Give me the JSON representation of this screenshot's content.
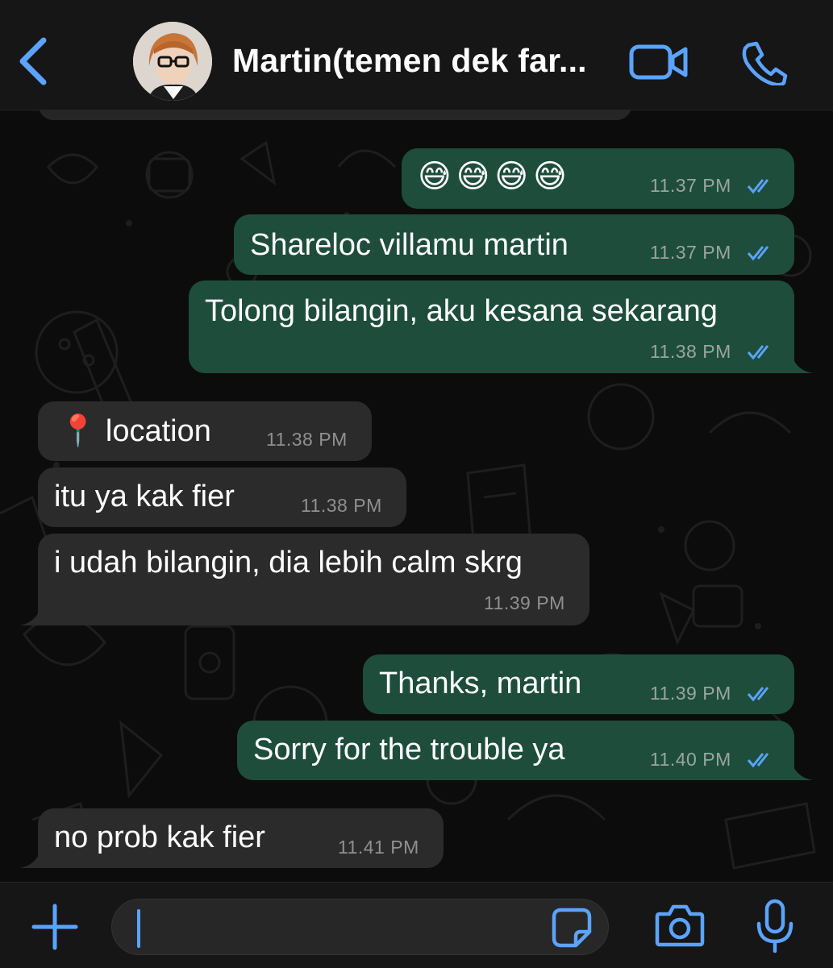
{
  "header": {
    "contact_name": "Martin(temen dek far...",
    "back_icon": "chevron-left-icon",
    "video_icon": "video-camera-icon",
    "call_icon": "phone-icon",
    "accent_color": "#5aa3ff"
  },
  "messages": [
    {
      "direction": "outgoing",
      "text": "😅😅😅😅",
      "time": "11.37 PM",
      "status": "read"
    },
    {
      "direction": "outgoing",
      "text": "Shareloc villamu martin",
      "time": "11.37 PM",
      "status": "read"
    },
    {
      "direction": "outgoing",
      "text": "Tolong bilangin, aku kesana sekarang",
      "time": "11.38 PM",
      "status": "read"
    },
    {
      "direction": "incoming",
      "text": "📍 location",
      "time": "11.38 PM"
    },
    {
      "direction": "incoming",
      "text": "itu ya kak fier",
      "time": "11.38 PM"
    },
    {
      "direction": "incoming",
      "text": "i udah bilangin, dia lebih calm skrg",
      "time": "11.39 PM"
    },
    {
      "direction": "outgoing",
      "text": "Thanks, martin",
      "time": "11.39 PM",
      "status": "read"
    },
    {
      "direction": "outgoing",
      "text": "Sorry for the trouble ya",
      "time": "11.40 PM",
      "status": "read"
    },
    {
      "direction": "incoming",
      "text": "no prob kak fier",
      "time": "11.41 PM"
    }
  ],
  "composer": {
    "input_value": "",
    "plus_icon": "plus-icon",
    "sticker_icon": "sticker-icon",
    "camera_icon": "camera-icon",
    "mic_icon": "microphone-icon"
  },
  "colors": {
    "outgoing_bubble": "#1e4d3c",
    "incoming_bubble": "#2b2b2c",
    "read_ticks": "#5aa3ff",
    "background": "#0b0b0b"
  }
}
